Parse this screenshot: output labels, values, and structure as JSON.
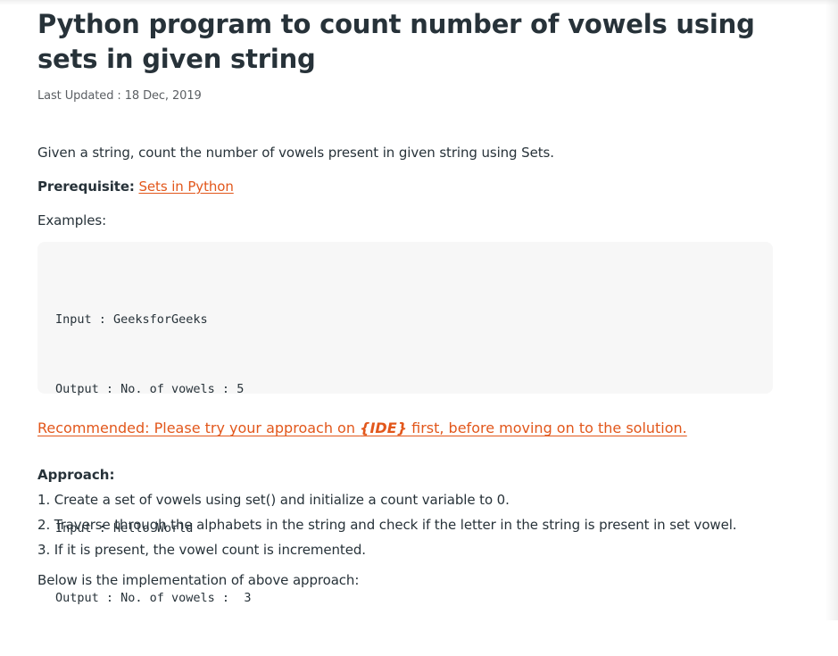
{
  "article": {
    "title": "Python program to count number of vowels using sets in given string",
    "last_updated": "Last Updated : 18 Dec, 2019",
    "intro": "Given a string, count the number of vowels present in given string using Sets.",
    "prerequisite_label": "Prerequisite:",
    "prerequisite_link": "Sets in Python",
    "examples_label": "Examples:",
    "code_lines": [
      "Input : GeeksforGeeks",
      "Output : No. of vowels : 5",
      "",
      "Input : Hello World",
      "Output : No. of vowels :  3"
    ],
    "recommended": {
      "before": "Recommended: Please try your approach on ",
      "ide": "{IDE}",
      "after": " first, before moving on to the solution."
    },
    "approach_heading": "Approach:",
    "steps": [
      "1. Create a set of vowels using set() and initialize a count variable to 0.",
      "2. Traverse through the alphabets in the string and check if the letter in the string is present in set vowel.",
      "3. If it is present, the vowel count is incremented."
    ],
    "below": "Below is the implementation of above approach:"
  },
  "colors": {
    "text": "#273239",
    "link": "#e2571b",
    "code_background": "#f7f7f7"
  }
}
